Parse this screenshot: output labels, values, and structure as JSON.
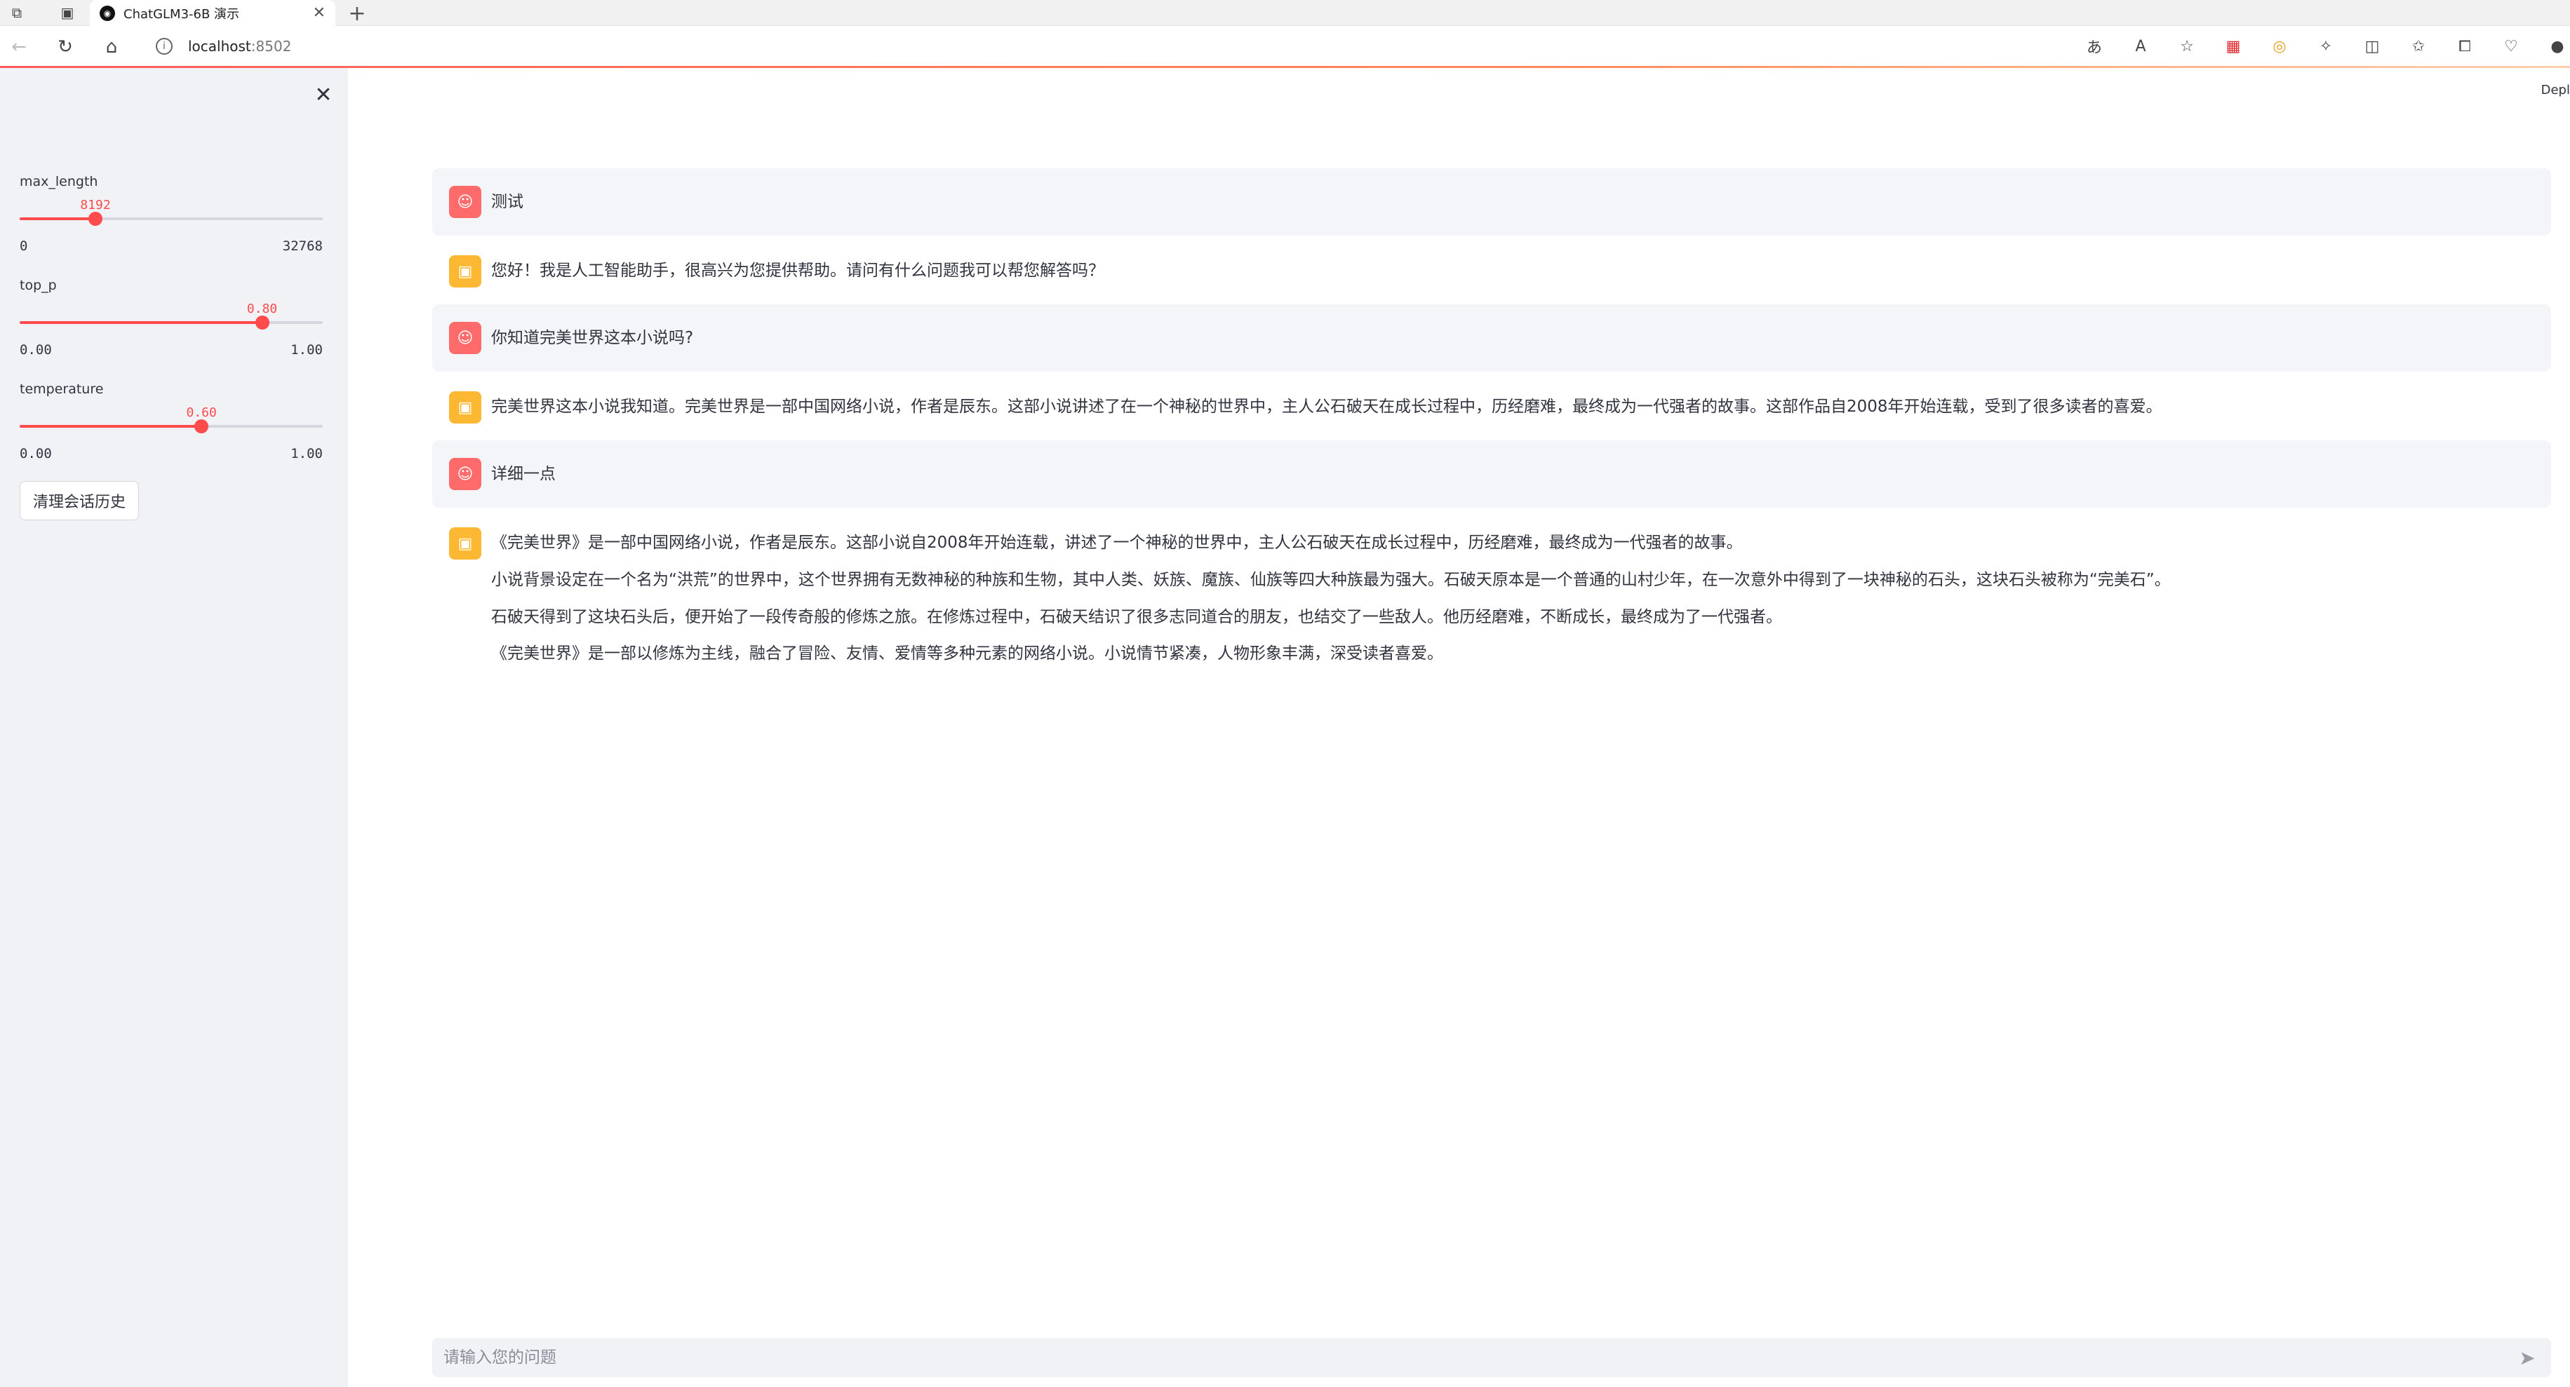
{
  "browser": {
    "tab_title": "ChatGLM3-6B 演示",
    "tab_favicon": "◉",
    "url_host": "localhost",
    "url_port": ":8502"
  },
  "sidebar": {
    "sliders": [
      {
        "label": "max_length",
        "value": "8192",
        "min": "0",
        "max": "32768",
        "fraction": 0.25
      },
      {
        "label": "top_p",
        "value": "0.80",
        "min": "0.00",
        "max": "1.00",
        "fraction": 0.8
      },
      {
        "label": "temperature",
        "value": "0.60",
        "min": "0.00",
        "max": "1.00",
        "fraction": 0.6
      }
    ],
    "clear_button": "清理会话历史"
  },
  "header": {
    "deploy": "Depl"
  },
  "chat": {
    "messages": [
      {
        "role": "user",
        "text": "测试"
      },
      {
        "role": "assistant",
        "paragraphs": [
          "您好！我是人工智能助手，很高兴为您提供帮助。请问有什么问题我可以帮您解答吗？"
        ]
      },
      {
        "role": "user",
        "text": "你知道完美世界这本小说吗?"
      },
      {
        "role": "assistant",
        "paragraphs": [
          "完美世界这本小说我知道。完美世界是一部中国网络小说，作者是辰东。这部小说讲述了在一个神秘的世界中，主人公石破天在成长过程中，历经磨难，最终成为一代强者的故事。这部作品自2008年开始连载，受到了很多读者的喜爱。"
        ]
      },
      {
        "role": "user",
        "text": "详细一点"
      },
      {
        "role": "assistant",
        "paragraphs": [
          "《完美世界》是一部中国网络小说，作者是辰东。这部小说自2008年开始连载，讲述了一个神秘的世界中，主人公石破天在成长过程中，历经磨难，最终成为一代强者的故事。",
          "小说背景设定在一个名为“洪荒”的世界中，这个世界拥有无数神秘的种族和生物，其中人类、妖族、魔族、仙族等四大种族最为强大。石破天原本是一个普通的山村少年，在一次意外中得到了一块神秘的石头，这块石头被称为“完美石”。",
          "石破天得到了这块石头后，便开始了一段传奇般的修炼之旅。在修炼过程中，石破天结识了很多志同道合的朋友，也结交了一些敌人。他历经磨难，不断成长，最终成为了一代强者。",
          "《完美世界》是一部以修炼为主线，融合了冒险、友情、爱情等多种元素的网络小说。小说情节紧凑，人物形象丰满，深受读者喜爱。"
        ]
      }
    ],
    "input_placeholder": "请输入您的问题"
  },
  "colors": {
    "accent": "#ff4b4b",
    "user_avatar": "#ff6b6b",
    "bot_avatar": "#fdb833",
    "sidebar_bg": "#f0f2f6"
  }
}
